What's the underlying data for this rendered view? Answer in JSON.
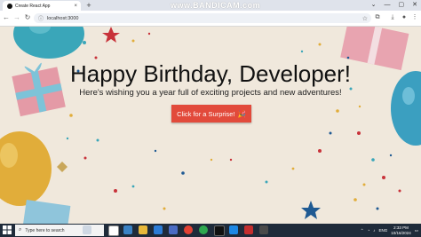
{
  "browser": {
    "tab_title": "Create React App",
    "tab_close": "×",
    "new_tab": "+",
    "url": "localhost:3000",
    "watermark": "www.BANDICAM.com",
    "window_controls": [
      "⌄",
      "—",
      "▢",
      "✕"
    ]
  },
  "page": {
    "heading": "Happy Birthday, Developer!",
    "subheading": "Here's wishing you a year full of exciting projects and new adventures!",
    "button_label": "Click for a Surprise!",
    "button_emoji": "🎉",
    "colors": {
      "background": "#f0e8dc",
      "button": "#e24a3b"
    }
  },
  "taskbar": {
    "search_placeholder": "Type here to search",
    "language": "ENG",
    "time": "2:33 PM",
    "date": "10/16/2024"
  }
}
